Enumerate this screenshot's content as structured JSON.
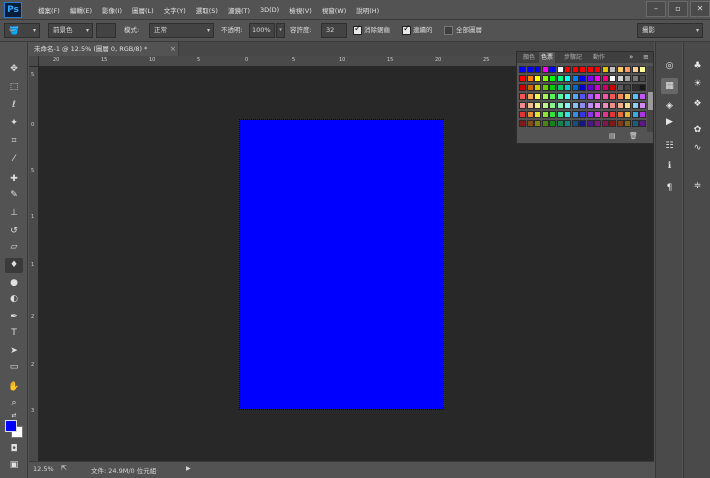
{
  "app": {
    "logo": "Ps"
  },
  "menu": [
    "檔案(F)",
    "編輯(E)",
    "影像(I)",
    "圖層(L)",
    "文字(Y)",
    "選取(S)",
    "濾鏡(T)",
    "3D(D)",
    "檢視(V)",
    "視窗(W)",
    "說明(H)"
  ],
  "window_controls": {
    "minimize": "–",
    "restore": "▫",
    "close": "✕"
  },
  "options": {
    "tool_icon": "paint-bucket-icon",
    "fill_source": "前景色",
    "mode_label": "模式:",
    "mode_value": "正常",
    "opacity_label": "不透明:",
    "opacity_value": "100%",
    "tolerance_label": "容許度:",
    "tolerance_value": "32",
    "antialias_label": "消除鋸齒",
    "antialias_checked": true,
    "contiguous_label": "連續的",
    "contiguous_checked": true,
    "all_layers_label": "全部圖層",
    "all_layers_checked": false,
    "workspace": "攝影"
  },
  "document": {
    "tab_title": "未命名-1 @ 12.5% (圖層 0, RGB/8) *",
    "tab_close": "×",
    "fill_color": "#0000ff"
  },
  "rulers": {
    "top": [
      "20",
      "15",
      "10",
      "5",
      "0",
      "5",
      "10",
      "15",
      "20",
      "25"
    ],
    "left": [
      "5",
      "0",
      "5",
      "1",
      "1",
      "2",
      "2",
      "3"
    ]
  },
  "toolbar": {
    "tools": [
      "move-tool-icon",
      "marquee-tool-icon",
      "lasso-tool-icon",
      "magic-wand-tool-icon",
      "crop-tool-icon",
      "eyedropper-tool-icon",
      "spot-healing-tool-icon",
      "brush-tool-icon",
      "clone-stamp-tool-icon",
      "history-brush-tool-icon",
      "eraser-tool-icon",
      "paint-bucket-tool-icon",
      "blur-tool-icon",
      "dodge-tool-icon",
      "pen-tool-icon",
      "type-tool-icon",
      "path-selection-tool-icon",
      "rectangle-tool-icon",
      "hand-tool-icon",
      "zoom-tool-icon"
    ],
    "active_tool": "paint-bucket-tool-icon",
    "foreground_color": "#0000ff",
    "background_color": "#ffffff"
  },
  "status": {
    "zoom": "12.5%",
    "doc_info": "文件: 24.9M/0 位元組",
    "arrow": "▶"
  },
  "swatches_panel": {
    "tabs": [
      "顏色",
      "色票",
      "步驟記",
      "動作"
    ],
    "active_tab": "色票",
    "menu_icons": [
      "collapse-icon",
      "panel-menu-icon"
    ],
    "footer_icons": [
      "new-swatch-icon",
      "delete-swatch-icon"
    ],
    "recent_colors": [
      "#0000ff",
      "#0000ff",
      "#0000ff",
      "#ff00ff",
      "#0000ff",
      "#ffffff",
      "#ff0000",
      "#ff0000",
      "#ff0000",
      "#ff0000",
      "#ff0000",
      "#e6c300",
      "#c0c0c0",
      "#ffcc66",
      "#ff9966",
      "#ffcc99",
      "#ffff99"
    ]
  },
  "dock": {
    "column1": [
      "layers-icon",
      "swatches-icon",
      "adjustments-icon",
      "play-icon",
      "properties-icon",
      "info-icon",
      "paragraph-icon"
    ],
    "column2": [
      "color-icon",
      "brightness-icon",
      "layers-stack-icon",
      "styles-icon",
      "paths-icon",
      "channels-icon"
    ]
  }
}
